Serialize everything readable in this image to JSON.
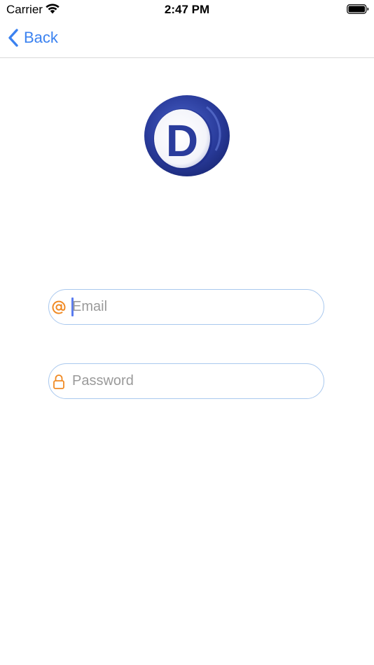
{
  "status_bar": {
    "carrier": "Carrier",
    "time": "2:47 PM",
    "wifi_icon": "wifi-icon",
    "battery_icon": "battery-icon"
  },
  "nav": {
    "back_label": "Back",
    "back_icon": "chevron-left-icon"
  },
  "logo": {
    "letter": "D",
    "icon": "app-logo"
  },
  "form": {
    "email": {
      "icon": "at-icon",
      "placeholder": "Email",
      "value": ""
    },
    "password": {
      "icon": "lock-icon",
      "placeholder": "Password",
      "value": ""
    }
  },
  "colors": {
    "accent": "#3b82f0",
    "field_border": "#a9c8ee",
    "icon_orange": "#f08a24",
    "logo_blue": "#2b3fa0"
  }
}
